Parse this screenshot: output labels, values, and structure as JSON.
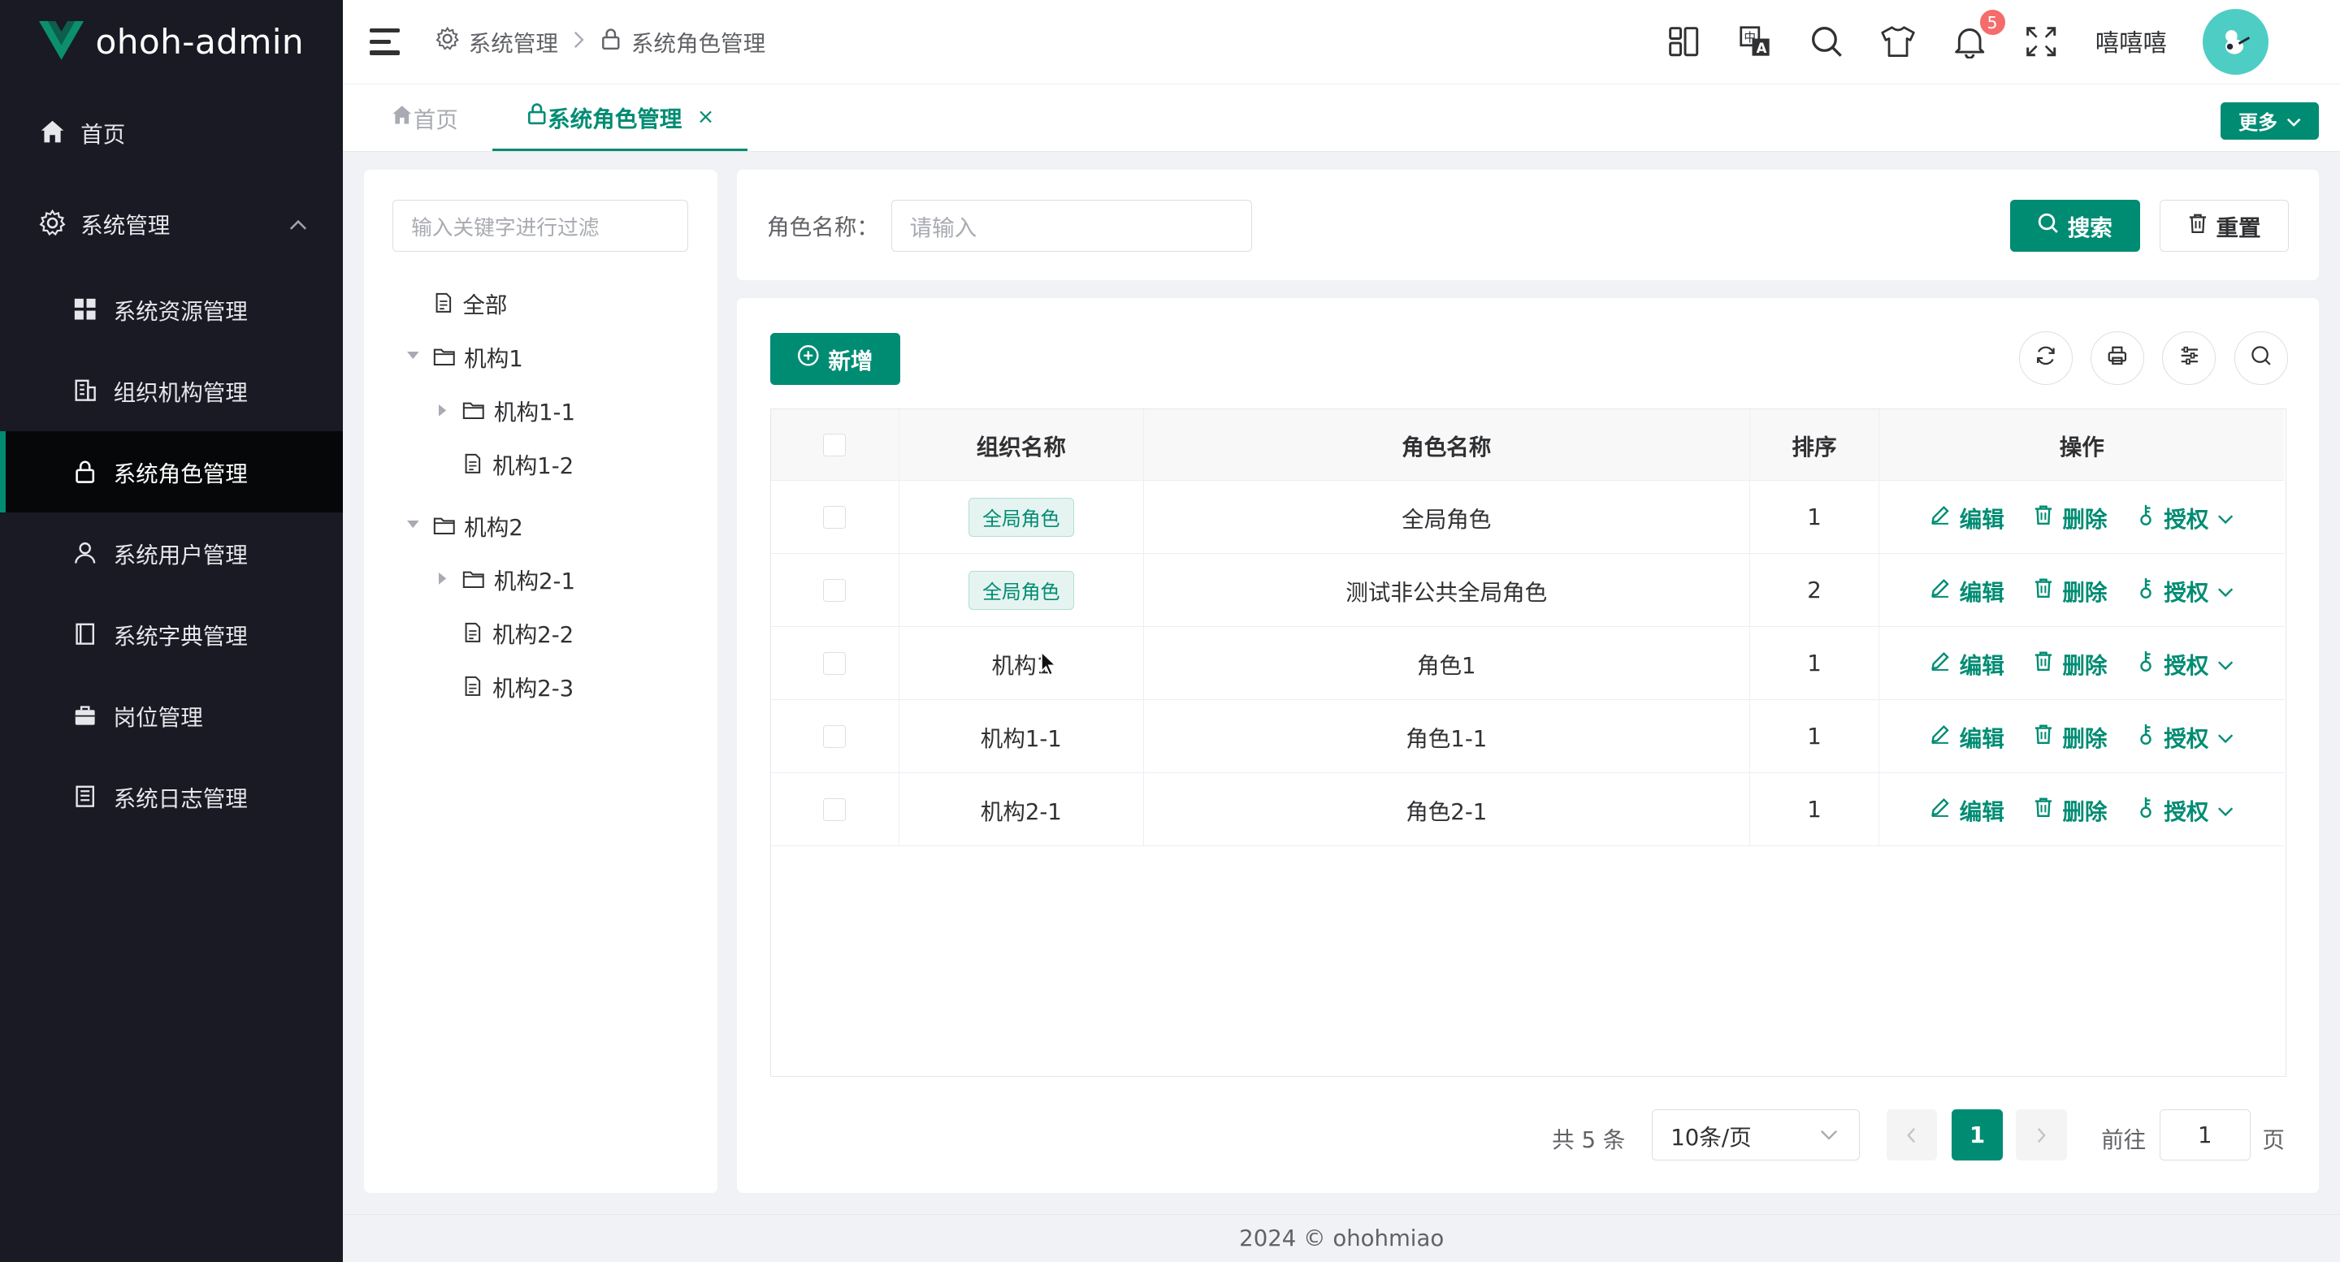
{
  "app": {
    "logo_text": "ohoh-admin"
  },
  "sidebar": {
    "home": "首页",
    "group": "系统管理",
    "items": [
      {
        "label": "系统资源管理",
        "icon": "grid-icon"
      },
      {
        "label": "组织机构管理",
        "icon": "building-icon"
      },
      {
        "label": "系统角色管理",
        "icon": "lock-icon",
        "active": true
      },
      {
        "label": "系统用户管理",
        "icon": "user-icon"
      },
      {
        "label": "系统字典管理",
        "icon": "book-icon"
      },
      {
        "label": "岗位管理",
        "icon": "briefcase-icon"
      },
      {
        "label": "系统日志管理",
        "icon": "log-icon"
      }
    ]
  },
  "header": {
    "breadcrumb": [
      "系统管理",
      "系统角色管理"
    ],
    "notifications": "5",
    "username": "嘻嘻嘻"
  },
  "tabs": {
    "home": "首页",
    "current": "系统角色管理",
    "close": "×",
    "more": "更多"
  },
  "tree": {
    "placeholder": "输入关键字进行过滤",
    "nodes": [
      "全部",
      "机构1",
      "机构1-1",
      "机构1-2",
      "机构2",
      "机构2-1",
      "机构2-2",
      "机构2-3"
    ]
  },
  "search": {
    "label": "角色名称：",
    "placeholder": "请输入",
    "search_button": "搜索",
    "reset_button": "重置"
  },
  "toolbar": {
    "add_button": "新增"
  },
  "table": {
    "columns": [
      "组织名称",
      "角色名称",
      "排序",
      "操作"
    ],
    "rows": [
      {
        "org": "全局角色",
        "org_tag": true,
        "role": "全局角色",
        "sort": "1"
      },
      {
        "org": "全局角色",
        "org_tag": true,
        "role": "测试非公共全局角色",
        "sort": "2"
      },
      {
        "org": "机构1",
        "org_tag": false,
        "role": "角色1",
        "sort": "1"
      },
      {
        "org": "机构1-1",
        "org_tag": false,
        "role": "角色1-1",
        "sort": "1"
      },
      {
        "org": "机构2-1",
        "org_tag": false,
        "role": "角色2-1",
        "sort": "1"
      }
    ],
    "actions": {
      "edit": "编辑",
      "delete": "删除",
      "grant": "授权"
    }
  },
  "pagination": {
    "total": "共 5 条",
    "page_size": "10条/页",
    "current": "1",
    "goto_label": "前往",
    "goto_value": "1",
    "page_suffix": "页"
  },
  "footer": {
    "text": "2024 © ohohmiao"
  },
  "colors": {
    "primary": "#008c73",
    "sidebar": "#191a23",
    "badge": "#f56c6c"
  }
}
